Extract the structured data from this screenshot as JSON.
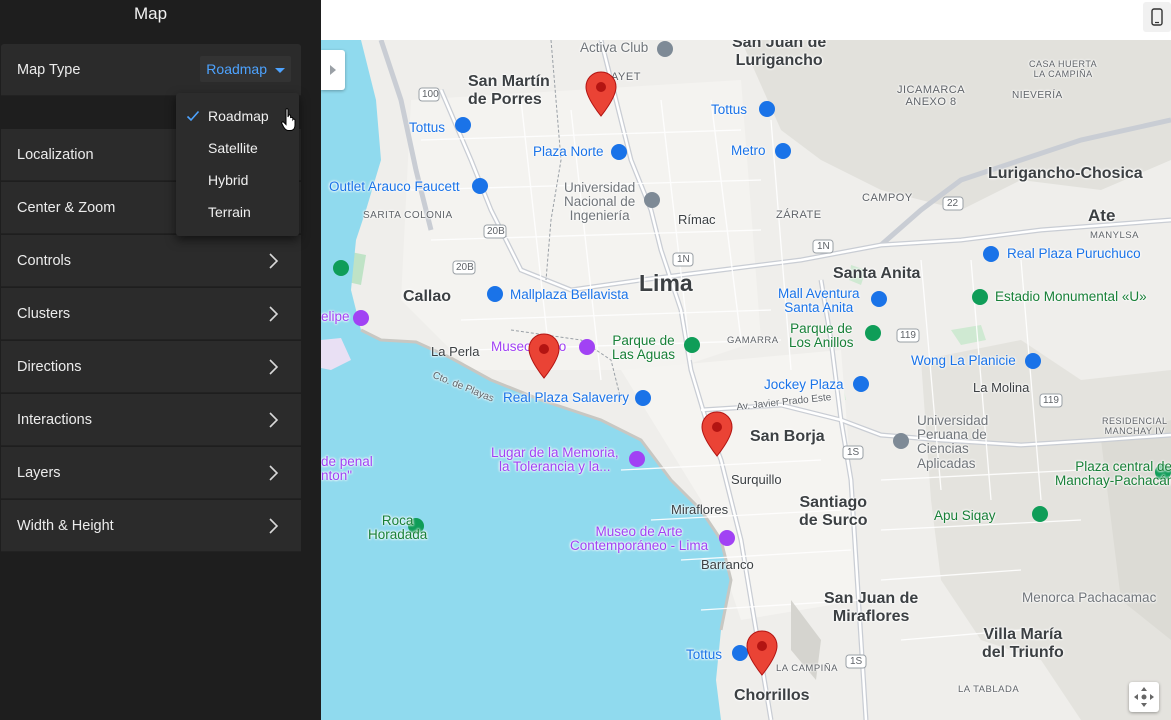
{
  "panel": {
    "title": "Map",
    "map_type": {
      "label": "Map Type",
      "selected": "Roadmap"
    },
    "dropdown_options": [
      "Roadmap",
      "Satellite",
      "Hybrid",
      "Terrain"
    ],
    "rows": [
      "Localization",
      "Center & Zoom",
      "Controls",
      "Clusters",
      "Directions",
      "Interactions",
      "Layers",
      "Width & Height"
    ]
  },
  "map": {
    "labels": {
      "lima": "Lima",
      "callao": "Callao",
      "san_martin": "San Martín\nde Porres",
      "sjl": "San Juan de\nLurigancho",
      "lurigancho": "Lurigancho-Chosica",
      "ate": "Ate",
      "santa_anita": "Santa Anita",
      "san_borja": "San Borja",
      "santiago": "Santiago\nde Surco",
      "sjm": "San Juan de\nMiraflores",
      "villa_maria": "Villa María\ndel Triunfo",
      "chorrillos": "Chorrillos",
      "la_perla": "La Perla",
      "rimac": "Rímac",
      "surquillo": "Surquillo",
      "miraflores": "Miraflores",
      "barranco": "Barranco",
      "la_molina": "La Molina",
      "jicamarca": "JICAMARCA\nANEXO 8",
      "casa_huerta": "CASA HUERTA\nLA CAMPIÑA",
      "nievería": "NIEVERÍA",
      "campoy": "CAMPOY",
      "zarate": "ZÁRATE",
      "manylsa": "MANYLSA",
      "gamarra": "GAMARRA",
      "sarita": "SARITA COLONIA",
      "la_campina": "LA CAMPIÑA",
      "la_tablada": "LA TABLADA",
      "residencial": "RESIDENCIAL\nMANCHAY IV",
      "activa_club": "Activa Club",
      "ayet": "AYET",
      "tottus1": "Tottus",
      "tottus2": "Tottus",
      "tottus3": "Tottus",
      "plaza_norte": "Plaza Norte",
      "metro": "Metro",
      "outlet": "Outlet Arauco Faucett",
      "uni": "Universidad\nNacional de\nIngeniería",
      "mallplaza": "Mallplaza Bellavista",
      "mall_aventura": "Mall Aventura\nSanta Anita",
      "real_plaza_pur": "Real Plaza Puruchuco",
      "estadio": "Estadio Monumental «U»",
      "parque_aguas": "Parque de\nLas Aguas",
      "parque_anillos": "Parque de\nLos Anillos",
      "wong": "Wong La Planicie",
      "jockey": "Jockey Plaza",
      "museo1": "Museo",
      "museo1b": "co",
      "real_plaza_sal": "Real Plaza Salaverry",
      "upc": "Universidad\nPeruana de\nCiencias\nAplicadas",
      "plaza_central": "Plaza central de\nManchay-Pachacámac",
      "apu": "Apu Siqay",
      "lugar": "Lugar de la Memoria,\nla Tolerancia y la...",
      "penal": "de penal\nnton\"",
      "roca": "Roca\nHoradada",
      "museo_arte": "Museo de Arte\nContemporáneo - Lima",
      "menorca": "Menorca Pachacamac",
      "elipe": "elipe",
      "av_javier": "Av. Javier Prado Este",
      "cto_playas": "Cto. de Playas",
      "r100": "100",
      "r20b": "20B",
      "r20b2": "20B",
      "r1n": "1N",
      "r1n2": "1N",
      "r22": "22",
      "r119": "119",
      "r119b": "119",
      "r1s": "1S",
      "r1s2": "1S"
    }
  },
  "colors": {
    "panel_bg": "#1e1e1e",
    "row_bg": "#2b2b2b",
    "accent": "#4da3ff",
    "water": "#90daee",
    "pin": "#ea4335"
  }
}
